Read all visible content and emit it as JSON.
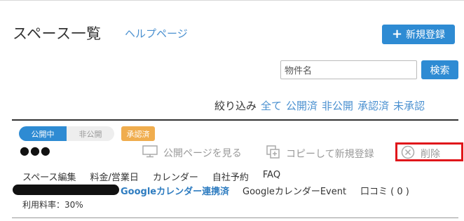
{
  "header": {
    "title": "スペース一覧",
    "help_link": "ヘルプページ",
    "new_button_label": "新規登録",
    "new_button_icon": "plus-icon"
  },
  "search": {
    "input_value": "物件名",
    "button_label": "検索"
  },
  "filter": {
    "label": "絞り込み",
    "options": [
      "全て",
      "公開済",
      "非公開",
      "承認済",
      "未承認"
    ]
  },
  "space": {
    "toggle_on": "公開中",
    "toggle_off": "非公開",
    "badge": "承認済",
    "name": "●●●",
    "actions": {
      "view": "公開ページを見る",
      "copy": "コピーして新規登録",
      "delete": "削除"
    },
    "menu": [
      "スペース編集",
      "料金/営業日",
      "カレンダー",
      "自社予約",
      "FAQ"
    ],
    "google_calendar_linked": "Googleカレンダー連携済",
    "google_calendar_event": "GoogleカレンダーEvent",
    "reviews": "口コミ ( 0 )",
    "usage_rate": "利用料率：30%"
  },
  "colors": {
    "primary": "#2e8bd3",
    "link": "#4a90d0",
    "badge": "#f0ad4e",
    "highlight": "#e0161b"
  }
}
